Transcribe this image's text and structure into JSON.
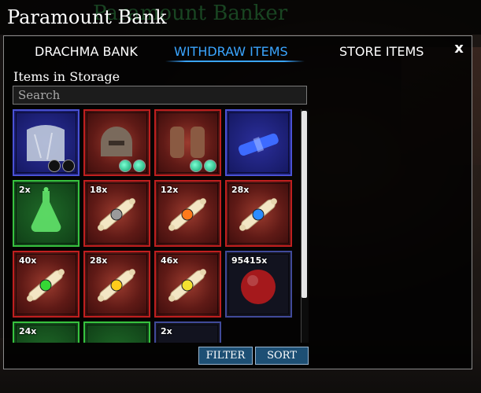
{
  "window": {
    "background_title": "Paramount Banker",
    "title": "Paramount Bank",
    "close_label": "x"
  },
  "tabs": [
    {
      "label": "DRACHMA BANK",
      "active": false
    },
    {
      "label": "WITHDRAW ITEMS",
      "active": true
    },
    {
      "label": "STORE ITEMS",
      "active": false
    }
  ],
  "storage": {
    "section_label": "Items in Storage",
    "search_placeholder": "Search"
  },
  "items": [
    {
      "name": "crystal-armor",
      "frame": "blue",
      "quantity": "",
      "gems": [
        "empty",
        "empty"
      ],
      "icon": "crystal-icon",
      "color": "#c9d3e0"
    },
    {
      "name": "bronze-helmet",
      "frame": "red",
      "quantity": "",
      "gems": [
        "emerald",
        "emerald"
      ],
      "icon": "helmet-icon",
      "color": "#7a6a5c"
    },
    {
      "name": "leather-gauntlets",
      "frame": "red",
      "quantity": "",
      "gems": [
        "emerald",
        "emerald"
      ],
      "icon": "gauntlets-icon",
      "color": "#8a5a42"
    },
    {
      "name": "blue-scroll-case",
      "frame": "blue",
      "quantity": "",
      "gems": [],
      "icon": "scroll-case-icon",
      "color": "#3d6bff"
    },
    {
      "name": "green-potion",
      "frame": "green",
      "quantity": "2x",
      "gems": [],
      "icon": "potion-icon",
      "color": "#62e36a"
    },
    {
      "name": "white-gem-scroll",
      "frame": "red",
      "quantity": "18x",
      "gems": [],
      "icon": "scroll-icon",
      "gem_color": "#9a9a9a"
    },
    {
      "name": "orange-gem-scroll",
      "frame": "red",
      "quantity": "12x",
      "gems": [],
      "icon": "scroll-icon",
      "gem_color": "#ff7a1a"
    },
    {
      "name": "blue-gem-scroll",
      "frame": "red",
      "quantity": "28x",
      "gems": [],
      "icon": "scroll-icon",
      "gem_color": "#2b8cff"
    },
    {
      "name": "green-gem-scroll",
      "frame": "red",
      "quantity": "40x",
      "gems": [],
      "icon": "scroll-icon",
      "gem_color": "#35d635"
    },
    {
      "name": "yellow-gem-scroll",
      "frame": "red",
      "quantity": "28x",
      "gems": [],
      "icon": "scroll-icon",
      "gem_color": "#ffcc1a"
    },
    {
      "name": "gold-gem-scroll",
      "frame": "red",
      "quantity": "46x",
      "gems": [],
      "icon": "scroll-icon",
      "gem_color": "#f2e030"
    },
    {
      "name": "red-orb",
      "frame": "navy",
      "quantity": "95415x",
      "gems": [],
      "icon": "orb-icon",
      "color": "#a5191c"
    },
    {
      "name": "item-row4-a",
      "frame": "green",
      "quantity": "24x",
      "gems": [],
      "icon": "item-icon",
      "color": "#cfcfcf"
    },
    {
      "name": "item-row4-b",
      "frame": "green",
      "quantity": "",
      "gems": [],
      "icon": "item-icon",
      "color": "#cfcfcf"
    },
    {
      "name": "item-row4-c",
      "frame": "navy",
      "quantity": "2x",
      "gems": [],
      "icon": "item-icon",
      "color": "#cfcfcf"
    }
  ],
  "buttons": {
    "filter": "FILTER",
    "sort": "SORT"
  },
  "colors": {
    "active_tab": "#3aa5ff",
    "button_bg": "#1d4f74",
    "rarity_red": "#c01f1f",
    "rarity_green": "#37c23f",
    "rarity_blue": "#4a52d6"
  }
}
